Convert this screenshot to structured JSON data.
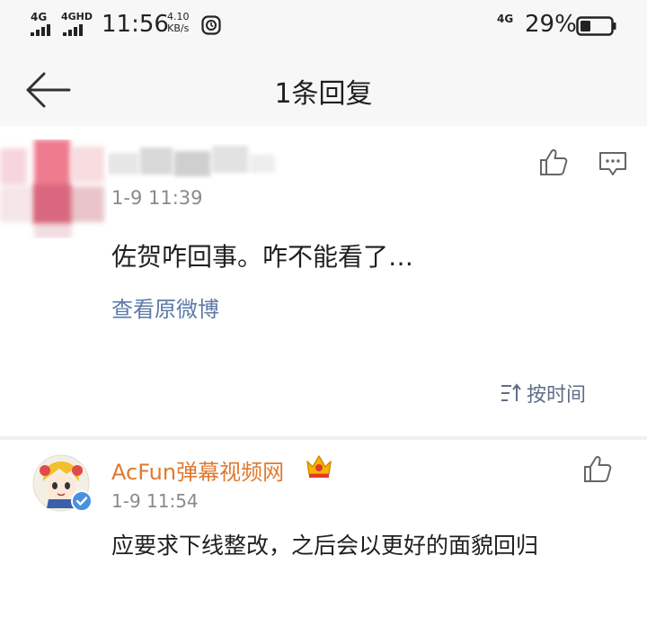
{
  "status_bar": {
    "network_1": "4G",
    "network_2": "4GHD",
    "time": "11:56",
    "speed_value": "4.10",
    "speed_unit": "KB/s",
    "right_network": "4G",
    "battery_percent": "29%",
    "icons": [
      "signal-icon",
      "alarm-icon",
      "battery-icon"
    ]
  },
  "header": {
    "title": "1条回复",
    "back_icon": "back-arrow-icon"
  },
  "main_comment": {
    "time": "1-9 11:39",
    "text": "佐贺咋回事。咋不能看了…",
    "view_original": "查看原微博",
    "sort_label": "按时间",
    "icons": [
      "like-icon",
      "reply-icon",
      "sort-icon"
    ]
  },
  "replies": [
    {
      "name": "AcFun弹幕视频网",
      "time": "1-9 11:54",
      "text": "应要求下线整改，之后会以更好的面貌回归",
      "icons": [
        "verified-icon",
        "crown-icon",
        "like-icon"
      ]
    }
  ],
  "colors": {
    "link": "#5b7aa6",
    "username": "#e0792f",
    "meta": "#8a8a8a",
    "header_bg": "#f7f7f7"
  }
}
